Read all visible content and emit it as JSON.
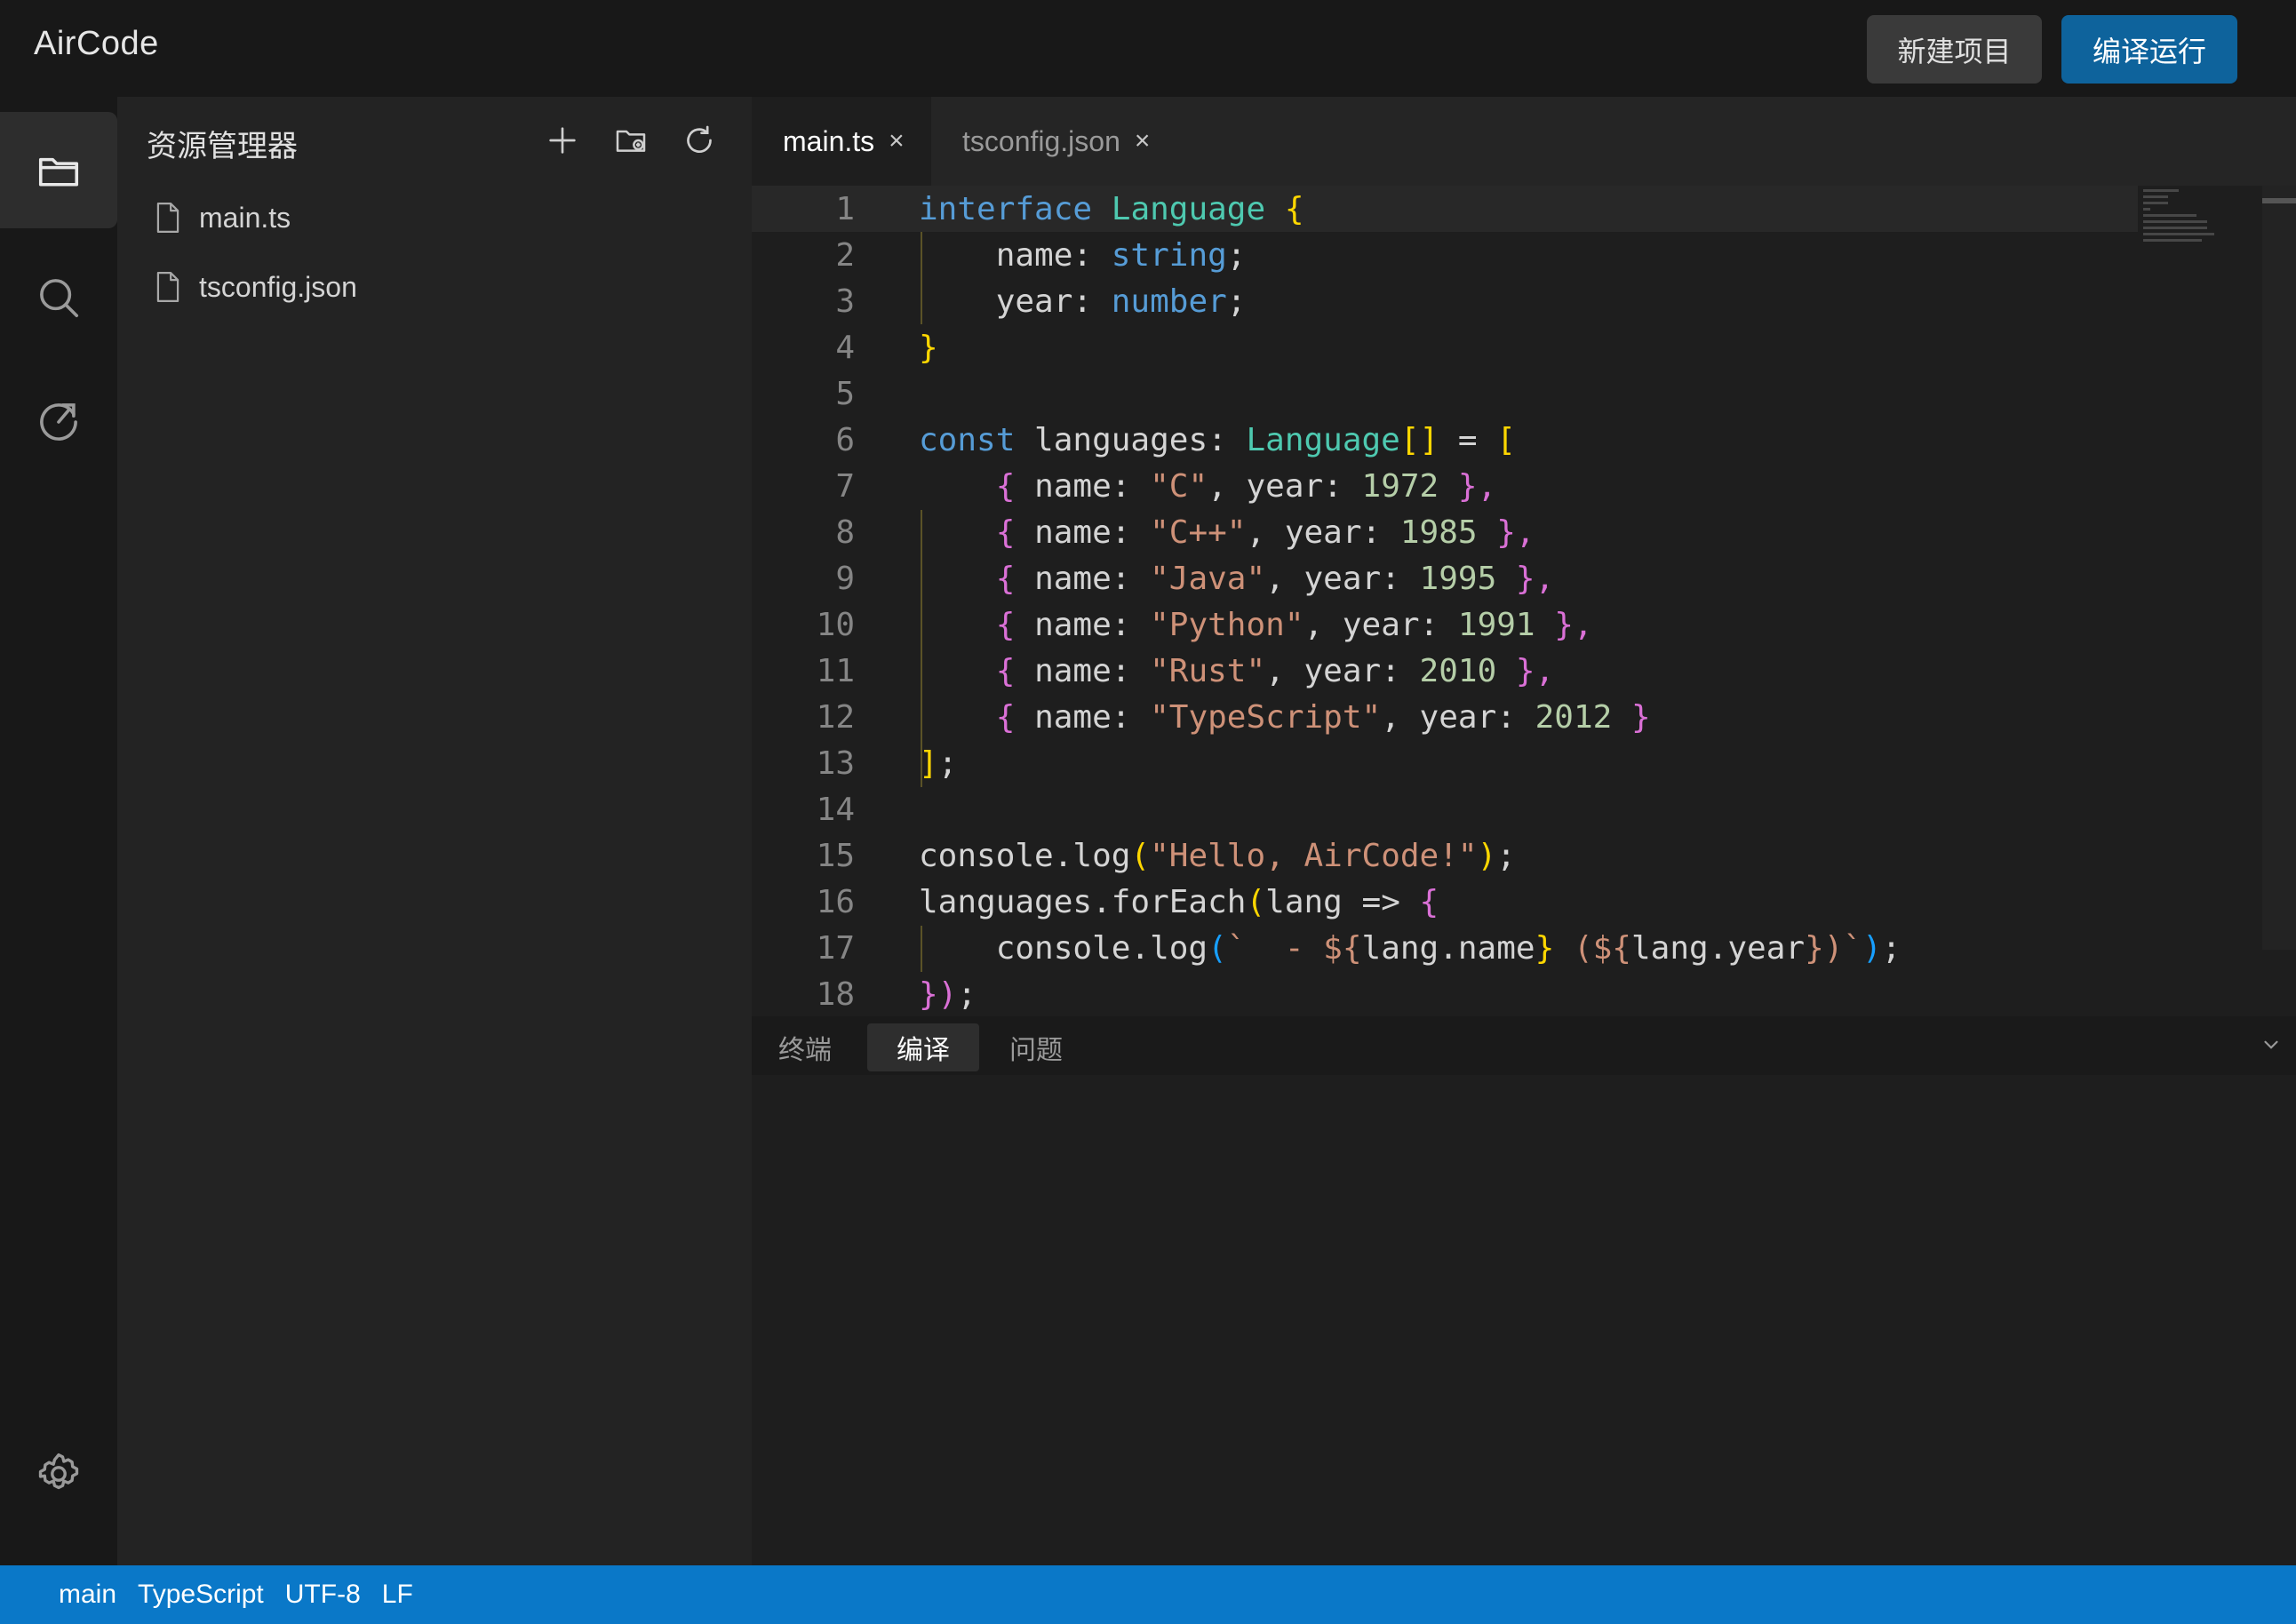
{
  "app": {
    "title": "AirCode"
  },
  "header": {
    "new_project_label": "新建项目",
    "compile_run_label": "编译运行"
  },
  "activity_bar": {
    "items": [
      "folder-icon",
      "search-icon",
      "history-icon"
    ],
    "settings_icon": "gear-icon"
  },
  "explorer": {
    "title": "资源管理器",
    "actions": [
      "new-file-icon",
      "new-folder-icon",
      "refresh-icon"
    ],
    "files": [
      {
        "name": "main.ts"
      },
      {
        "name": "tsconfig.json"
      }
    ]
  },
  "editor": {
    "tabs": [
      {
        "label": "main.ts",
        "active": true
      },
      {
        "label": "tsconfig.json",
        "active": false
      }
    ],
    "close_glyph": "×",
    "line_numbers": [
      "1",
      "2",
      "3",
      "4",
      "5",
      "6",
      "7",
      "8",
      "9",
      "10",
      "11",
      "12",
      "13",
      "14",
      "15",
      "16",
      "17",
      "18"
    ],
    "code": {
      "l1": [
        "interface",
        " ",
        "Language",
        " ",
        "{"
      ],
      "l2": [
        "    name: ",
        "string",
        ";"
      ],
      "l3": [
        "    year: ",
        "number",
        ";"
      ],
      "l4": [
        "}"
      ],
      "l6": [
        "const",
        " languages: ",
        "Language",
        "[]",
        " = ",
        "["
      ],
      "rows": [
        {
          "name": "\"C\"",
          "year": "1972",
          "tail": " },"
        },
        {
          "name": "\"C++\"",
          "year": "1985",
          "tail": " },"
        },
        {
          "name": "\"Java\"",
          "year": "1995",
          "tail": " },"
        },
        {
          "name": "\"Python\"",
          "year": "1991",
          "tail": " },"
        },
        {
          "name": "\"Rust\"",
          "year": "2010",
          "tail": " },"
        },
        {
          "name": "\"TypeScript\"",
          "year": "2012",
          "tail": " }"
        }
      ],
      "row_open": "{",
      "row_name_key": " name: ",
      "row_year_key": ", year: ",
      "l13": [
        "]",
        ";"
      ],
      "l15": [
        "console.log",
        "(",
        "\"Hello, AirCode!\"",
        ")",
        ";"
      ],
      "l16": [
        "languages.forEach",
        "(",
        "lang => ",
        "{"
      ],
      "l17": [
        "    console.log",
        "(",
        "`  - ${",
        "lang.name",
        "}",
        " (${",
        "lang.year",
        "})`",
        ")",
        ";"
      ],
      "l18": [
        "})",
        ";"
      ]
    }
  },
  "panel": {
    "tabs": [
      {
        "label": "终端",
        "active": false
      },
      {
        "label": "编译",
        "active": true
      },
      {
        "label": "问题",
        "active": false
      }
    ],
    "collapse_icon": "chevron-down-icon"
  },
  "statusbar": {
    "branch": "main",
    "language": "TypeScript",
    "encoding": "UTF-8",
    "eol": "LF"
  },
  "colors": {
    "accent": "#0e639c",
    "status_bar": "#0a78c8",
    "keyword": "#569cd6",
    "type": "#4ec9b0",
    "string": "#ce9178",
    "number": "#b5cea8"
  }
}
